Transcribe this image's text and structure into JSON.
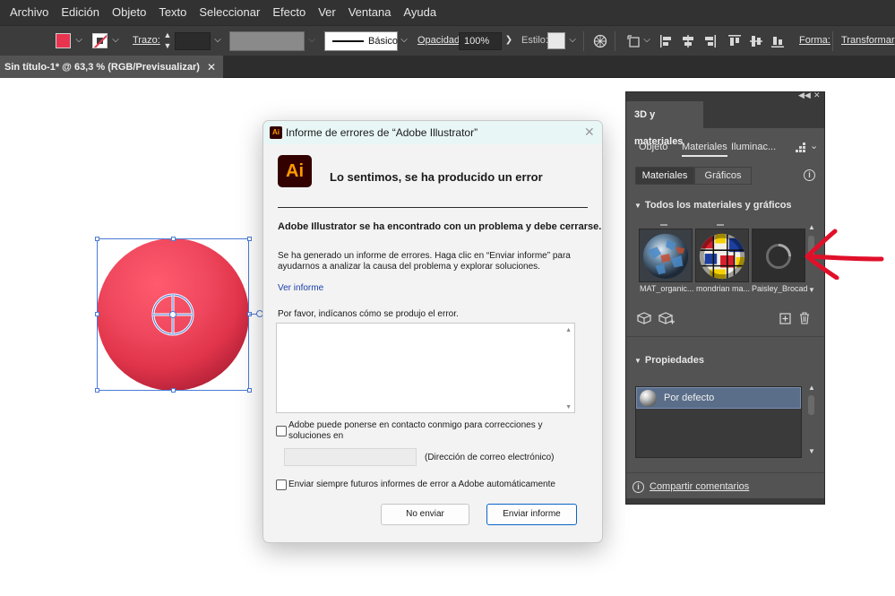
{
  "menubar": {
    "items": [
      "Archivo",
      "Edición",
      "Objeto",
      "Texto",
      "Seleccionar",
      "Efecto",
      "Ver",
      "Ventana",
      "Ayuda"
    ]
  },
  "controlbar": {
    "fill_color": "#e8344f",
    "stroke_label": "Trazo:",
    "brush_label": "Básico",
    "opacity_label": "Opacidad:",
    "opacity_value": "100%",
    "style_label": "Estilo:",
    "shape_label": "Forma:",
    "transform_label": "Transformar"
  },
  "document": {
    "tab_title": "Sin título-1* @ 63,3 % (RGB/Previsualizar)",
    "close_glyph": "✕"
  },
  "canvas": {
    "sphere_color": "#e8344f",
    "selection_color": "#4a7bd6"
  },
  "panel": {
    "title": "3D y materiales",
    "tabs": [
      "Objeto",
      "Materiales",
      "Iluminac..."
    ],
    "active_tab": "Materiales",
    "segments": [
      "Materiales",
      "Gráficos"
    ],
    "active_segment": "Materiales",
    "materials_section": "Todos los materiales y gráficos",
    "materials": [
      {
        "label": "MAT_organic...",
        "icon": "metal-sphere-thumbnail"
      },
      {
        "label": "mondrian ma...",
        "icon": "mondrian-sphere-thumbnail"
      },
      {
        "label": "Paisley_Brocade",
        "icon": "loading-spinner-thumbnail"
      }
    ],
    "properties_section": "Propiedades",
    "property_item": "Por defecto",
    "share_label": "Compartir comentarios"
  },
  "dialog": {
    "title": "Informe de errores de “Adobe Illustrator”",
    "app_icon_text": "Ai",
    "headline": "Lo sentimos, se ha producido un error",
    "bold_message": "Adobe Illustrator se ha encontrado con un problema y debe cerrarse.",
    "paragraph": "Se ha generado un informe de errores. Haga clic en “Enviar informe” para ayudarnos a analizar la causa del problema y explorar soluciones.",
    "view_report": "Ver informe",
    "prompt": "Por favor, indícanos cómo se produjo el error.",
    "contact_checkbox": "Adobe puede ponerse en contacto conmigo para correcciones y soluciones en",
    "email_hint": "(Dirección de correo electrónico)",
    "always_send_checkbox": "Enviar siempre futuros informes de error a Adobe automáticamente",
    "no_send_button": "No enviar",
    "send_button": "Enviar informe",
    "accent_color": "#0a64c8"
  },
  "annotation": {
    "arrow_color": "#e0102a"
  }
}
